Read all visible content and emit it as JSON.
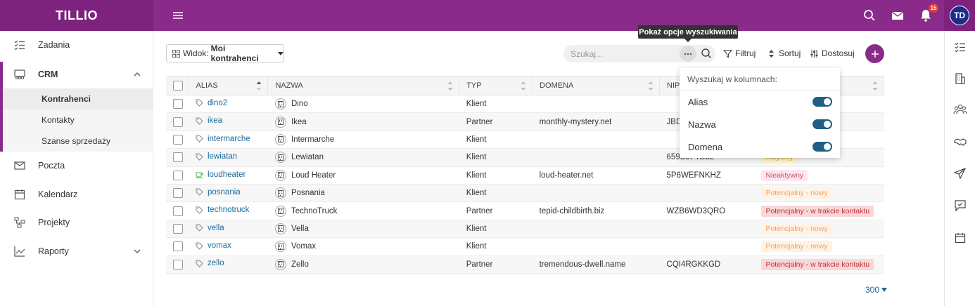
{
  "app": {
    "brand": "TILLIO",
    "notifications_count": "15",
    "user_initials": "TD"
  },
  "sidebar": {
    "items": [
      {
        "label": "Zadania",
        "icon": "tasks-icon"
      },
      {
        "label": "CRM",
        "icon": "crm-icon",
        "expanded": true
      },
      {
        "label": "Poczta",
        "icon": "mail-icon"
      },
      {
        "label": "Kalendarz",
        "icon": "calendar-icon"
      },
      {
        "label": "Projekty",
        "icon": "projects-icon"
      },
      {
        "label": "Raporty",
        "icon": "reports-icon"
      }
    ],
    "crm_sub": [
      "Kontrahenci",
      "Kontakty",
      "Szanse sprzedaży"
    ]
  },
  "toolbar": {
    "view_label": "Widok:",
    "view_value": "Moi kontrahenci",
    "search_placeholder": "Szukaj...",
    "filter_label": "Filtruj",
    "sort_label": "Sortuj",
    "customize_label": "Dostosuj",
    "tooltip": "Pokaż opcje wyszukiwania"
  },
  "search_panel": {
    "title": "Wyszukaj w kolumnach:",
    "options": [
      {
        "label": "Alias",
        "enabled": true
      },
      {
        "label": "Nazwa",
        "enabled": true
      },
      {
        "label": "Domena",
        "enabled": true
      }
    ]
  },
  "table": {
    "headers": {
      "alias": "ALIAS",
      "name": "NAZWA",
      "type": "TYP",
      "domain": "DOMENA",
      "nip": "NIP"
    },
    "rows": [
      {
        "alias": "dino2",
        "name": "Dino",
        "type": "Klient",
        "domain": "",
        "nip": "",
        "status": ""
      },
      {
        "alias": "ikea",
        "name": "Ikea",
        "type": "Partner",
        "domain": "monthly-mystery.net",
        "nip": "JBD",
        "status": ""
      },
      {
        "alias": "intermarche",
        "name": "Intermarche",
        "type": "Klient",
        "domain": "",
        "nip": "",
        "status": ""
      },
      {
        "alias": "lewiatan",
        "name": "Lewiatan",
        "type": "Klient",
        "domain": "",
        "nip": "659B974G32",
        "status": "Aktywny"
      },
      {
        "alias": "loudheater",
        "name": "Loud Heater",
        "type": "Klient",
        "domain": "loud-heater.net",
        "nip": "5P6WEFNKHZ",
        "status": "Nieaktywny"
      },
      {
        "alias": "posnania",
        "name": "Posnania",
        "type": "Klient",
        "domain": "",
        "nip": "",
        "status": "Potencjalny - nowy"
      },
      {
        "alias": "technotruck",
        "name": "TechnoTruck",
        "type": "Partner",
        "domain": "tepid-childbirth.biz",
        "nip": "WZB6WD3QRO",
        "status": "Potencjalny - w trakcie kontaktu"
      },
      {
        "alias": "vella",
        "name": "Vella",
        "type": "Klient",
        "domain": "",
        "nip": "",
        "status": "Potencjalny - nowy"
      },
      {
        "alias": "vomax",
        "name": "Vomax",
        "type": "Klient",
        "domain": "",
        "nip": "",
        "status": "Potencjalny - nowy"
      },
      {
        "alias": "zello",
        "name": "Zello",
        "type": "Partner",
        "domain": "tremendous-dwell.name",
        "nip": "CQI4RGKKGD",
        "status": "Potencjalny - w trakcie kontaktu"
      }
    ]
  },
  "pager": {
    "page_size": "300"
  }
}
